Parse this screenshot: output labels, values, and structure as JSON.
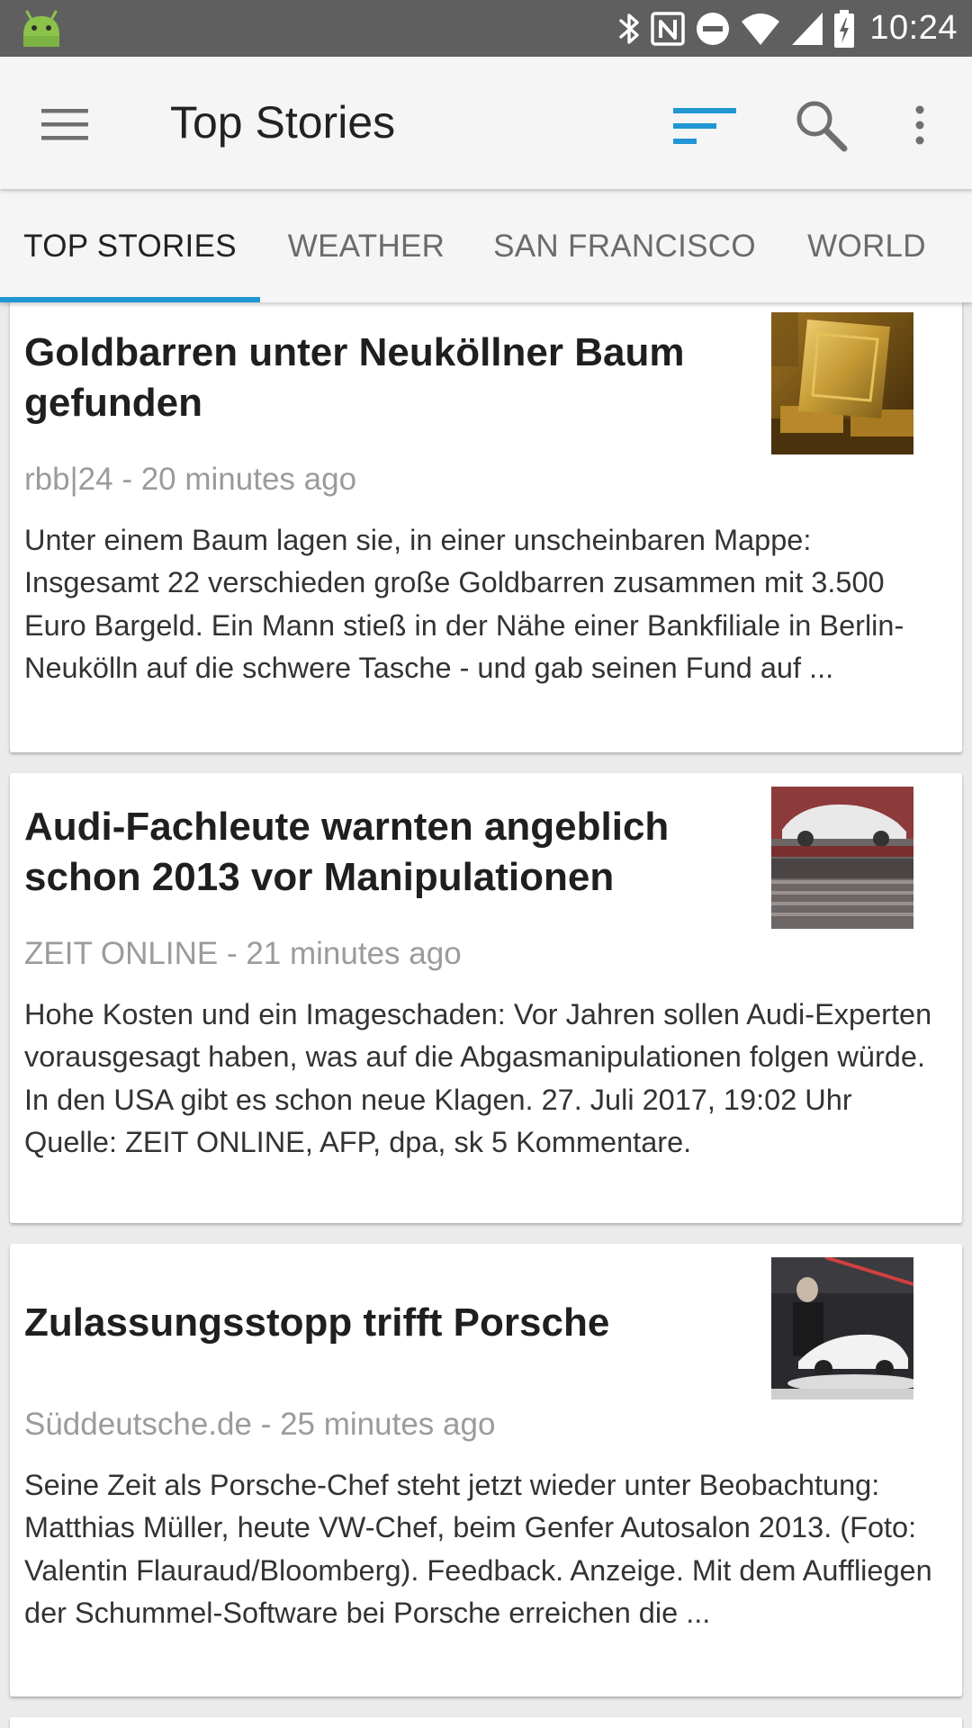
{
  "status_bar": {
    "time": "10:24",
    "icons": [
      "android-icon",
      "bluetooth-icon",
      "nfc-icon",
      "do-not-disturb-icon",
      "wifi-icon",
      "cell-signal-icon",
      "battery-charging-icon"
    ]
  },
  "app_bar": {
    "title": "Top Stories",
    "icons": [
      "hamburger-menu-icon",
      "sort-filter-icon",
      "search-icon",
      "more-vert-icon"
    ],
    "accent_color": "#2196d3"
  },
  "tabs": [
    {
      "label": "TOP STORIES",
      "active": true
    },
    {
      "label": "WEATHER",
      "active": false
    },
    {
      "label": "SAN FRANCISCO",
      "active": false
    },
    {
      "label": "WORLD",
      "active": false
    }
  ],
  "articles": [
    {
      "headline": "Goldbarren unter Neuköllner Baum gefunden",
      "meta": "rbb|24 - 20 minutes ago",
      "summary": "Unter einem Baum lagen sie, in einer unscheinbaren Mappe: Insgesamt 22 verschieden große Goldbarren zusammen mit 3.500 Euro Bargeld. Ein Mann stieß in der Nähe einer Bankfiliale in Berlin-Neukölln auf die schwere Tasche - und gab seinen Fund auf ...",
      "thumbnail": "gold-bars-image"
    },
    {
      "headline": "Audi-Fachleute warnten angeblich schon 2013 vor Manipulationen",
      "meta": "ZEIT ONLINE - 21 minutes ago",
      "summary": "Hohe Kosten und ein Imageschaden: Vor Jahren sollen Audi-Experten vorausgesagt haben, was auf die Abgasmanipulationen folgen würde. In den USA gibt es schon neue Klagen. 27. Juli 2017, 19:02 Uhr Quelle: ZEIT ONLINE, AFP, dpa, sk 5 Kommentare.",
      "thumbnail": "audi-car-train-image"
    },
    {
      "headline": "Zulassungsstopp trifft Porsche",
      "meta": "Süddeutsche.de - 25 minutes ago",
      "summary": "Seine Zeit als Porsche-Chef steht jetzt wieder unter Beobachtung: Matthias Müller, heute VW-Chef, beim Genfer Autosalon 2013. (Foto: Valentin Flauraud/Bloomberg). Feedback. Anzeige. Mit dem Auffliegen der Schummel-Software bei Porsche erreichen die ...",
      "thumbnail": "porsche-autosalon-image"
    }
  ]
}
